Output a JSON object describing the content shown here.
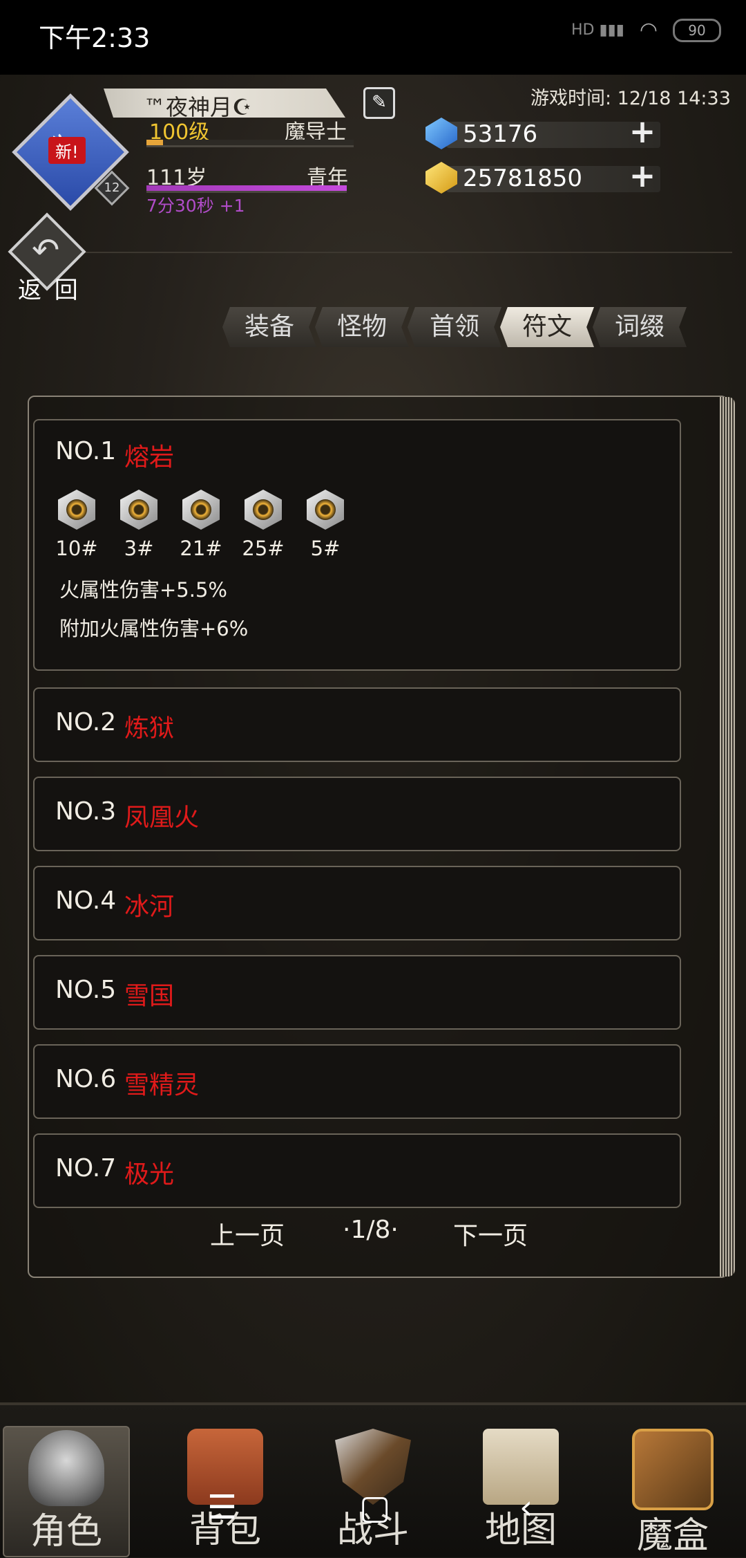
{
  "status_bar": {
    "time": "下午2:33",
    "hd": "HD",
    "battery": "90"
  },
  "player": {
    "avatar_badge": "新!",
    "avatar_level": "12",
    "name": "™夜神月☪",
    "level": "100级",
    "class": "魔导士",
    "level_progress": 0.08,
    "age": "111岁",
    "life_stage": "青年",
    "timer": "7分30秒 +1"
  },
  "game_time": "游戏时间: 12/18 14:33",
  "currency": {
    "diamonds": "53176",
    "gold": "25781850"
  },
  "back_label": "返 回",
  "tabs": [
    {
      "label": "装备",
      "active": false
    },
    {
      "label": "怪物",
      "active": false
    },
    {
      "label": "首领",
      "active": false
    },
    {
      "label": "符文",
      "active": true
    },
    {
      "label": "词缀",
      "active": false
    }
  ],
  "entries": [
    {
      "no": "NO.1",
      "name": "熔岩",
      "expanded": true,
      "runes": [
        "10#",
        "3#",
        "21#",
        "25#",
        "5#"
      ],
      "effects": [
        "火属性伤害+5.5%",
        "附加火属性伤害+6%"
      ]
    },
    {
      "no": "NO.2",
      "name": "炼狱"
    },
    {
      "no": "NO.3",
      "name": "凤凰火"
    },
    {
      "no": "NO.4",
      "name": "冰河"
    },
    {
      "no": "NO.5",
      "name": "雪国"
    },
    {
      "no": "NO.6",
      "name": "雪精灵"
    },
    {
      "no": "NO.7",
      "name": "极光"
    }
  ],
  "pager": {
    "prev": "上一页",
    "page": "·1/8·",
    "next": "下一页"
  },
  "bottom_nav": [
    {
      "label": "角色",
      "icon": "helmet-icon",
      "active": true
    },
    {
      "label": "背包",
      "icon": "backpack-icon",
      "active": false
    },
    {
      "label": "战斗",
      "icon": "shield-sword-icon",
      "active": false
    },
    {
      "label": "地图",
      "icon": "scroll-map-icon",
      "active": false
    },
    {
      "label": "魔盒",
      "icon": "magic-box-icon",
      "active": false
    }
  ]
}
